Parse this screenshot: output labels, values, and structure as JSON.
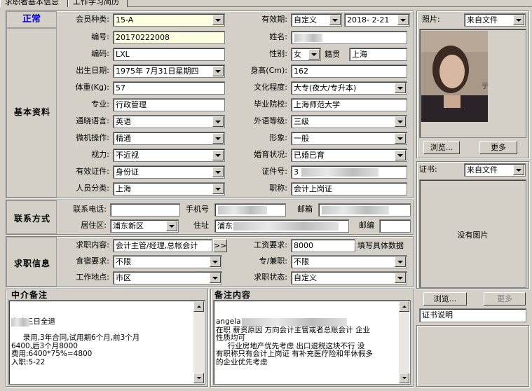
{
  "tabs": [
    "求职者基本信息",
    "工作学习简历"
  ],
  "status": "正常",
  "member_type": {
    "label": "会员种类:",
    "value": "15-A"
  },
  "validity": {
    "label": "有效期:",
    "value": "自定义",
    "date": "2018- 2-21"
  },
  "photo": {
    "label": "照片:",
    "source": "来自文件",
    "browse": "浏览...",
    "more": "更多"
  },
  "cert": {
    "label": "证书:",
    "source": "来自文件",
    "no_image": "没有图片",
    "browse": "浏览...",
    "more": "更多",
    "desc": "证书说明"
  },
  "basic": {
    "section": "基本资料",
    "number": {
      "label": "编号:",
      "value": "20170222008"
    },
    "name": {
      "label": "姓名:",
      "value": ""
    },
    "code": {
      "label": "编码:",
      "value": "LXL"
    },
    "gender": {
      "label": "性别:",
      "value": "女"
    },
    "native": {
      "label": "籍贯",
      "value": "上海"
    },
    "birth": {
      "label": "出生日期:",
      "value": "1975年 7月31日星期四"
    },
    "height": {
      "label": "身高(Cm):",
      "value": "162"
    },
    "weight": {
      "label": "体重(Kg):",
      "value": "57"
    },
    "education": {
      "label": "文化程度:",
      "value": "大专(夜大/专升本)"
    },
    "major": {
      "label": "专业:",
      "value": "行政管理"
    },
    "school": {
      "label": "毕业院校:",
      "value": "上海师范大学"
    },
    "language": {
      "label": "通晓语言:",
      "value": "英语"
    },
    "lang_level": {
      "label": "外语等级:",
      "value": "三级"
    },
    "computer": {
      "label": "微机操作:",
      "value": "精通"
    },
    "appearance": {
      "label": "形象:",
      "value": "一般"
    },
    "vision": {
      "label": "视力:",
      "value": "不近视"
    },
    "marital": {
      "label": "婚育状况:",
      "value": "已婚已育"
    },
    "id_type": {
      "label": "有效证件:",
      "value": "身份证"
    },
    "id_no": {
      "label": "证件号:",
      "value": "3"
    },
    "category": {
      "label": "人员分类:",
      "value": "上海"
    },
    "title": {
      "label": "职称:",
      "value": "会计上岗证"
    }
  },
  "contact": {
    "section": "联系方式",
    "phone": {
      "label": "联系电话:",
      "value": ""
    },
    "mobile": {
      "label": "手机号",
      "value": ""
    },
    "email": {
      "label": "邮箱",
      "value": ""
    },
    "district": {
      "label": "居住区:",
      "value": "浦东新区"
    },
    "address": {
      "label": "住址",
      "value": "浦东"
    },
    "zip": {
      "label": "邮编",
      "value": ""
    }
  },
  "job": {
    "section": "求职信息",
    "want": {
      "label": "求职内容:",
      "value": "会计主管/经理,总帐会计",
      "btn": ">>"
    },
    "salary": {
      "label": "工资要求:",
      "value": "8000",
      "hint": "填写具体数据"
    },
    "board": {
      "label": "食宿要求:",
      "value": "不限"
    },
    "parttime": {
      "label": "专/兼职:",
      "value": "不限"
    },
    "location": {
      "label": "工作地点:",
      "value": "市区"
    },
    "state": {
      "label": "求职状态:",
      "value": "自定义"
    }
  },
  "agent_notes": {
    "label": "中介备注",
    "text": "上班三日全退\n\n     录用,3年合同,试用期6个月,前3个月\n6400,后3个月8000\n费用:6400*75%=4800\n入职:5-22"
  },
  "notes": {
    "label": "备注内容",
    "text": "angela\n在职 薪资原因 方向会计主管或者总账会计 企业\n性质均可\n     行业房地产优先考虑 出口退税这块不行 没\n有职称只有会计上岗证 有补充医疗险和年休假多\n的企业优先考虑"
  }
}
